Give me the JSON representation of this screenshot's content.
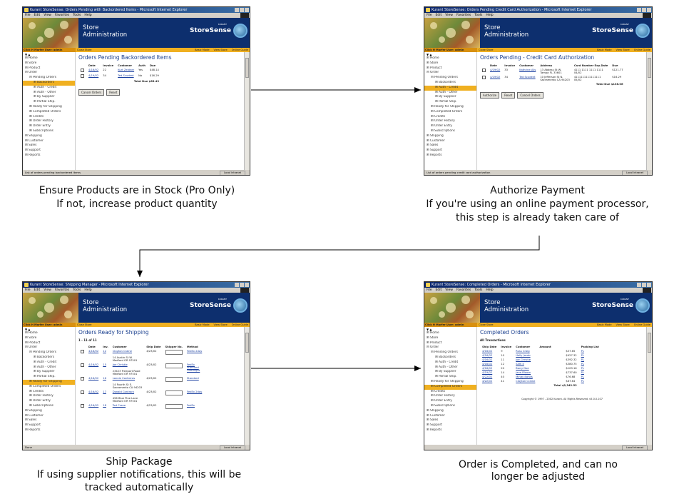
{
  "panels": {
    "p1": {
      "window_title": "Kurant StoreSense: Orders Pending with Backordered Items - Microsoft Internet Explorer",
      "status": "List of orders pending backordered items",
      "page_title": "Orders Pending Backordered Items",
      "selected_tree": "Backorders",
      "headers": [
        "Date",
        "Invoice",
        "Customer",
        "Auth",
        "Due"
      ],
      "rows": [
        {
          "date": "4/16/02",
          "invoice": "22",
          "customer": "Kurt Zeldner",
          "auth": "Yes",
          "due": "$48.14"
        },
        {
          "date": "4/19/02",
          "invoice": "34",
          "customer": "Ted Scudent",
          "auth": "No",
          "due": "$16.29"
        }
      ],
      "total": "Total Due $56.43",
      "buttons": [
        "Cancel Orders",
        "Reset"
      ]
    },
    "p2": {
      "window_title": "Kurant StoreSense: Orders Pending Credit Card Authorization - Microsoft Internet Explorer",
      "status": "List of orders pending credit card authorization",
      "page_title": "Orders Pending - Credit Card Authorization",
      "selected_tree": "Auth - Credit",
      "headers": [
        "Date",
        "Invoice",
        "Customer",
        "Address",
        "Card Number Exp.Date",
        "Due"
      ],
      "rows": [
        {
          "date": "4/19/02",
          "invoice": "33",
          "customer": "Kathrine Alis",
          "address1": "13 Abbess St W.",
          "address2": "Tampa FL 33601",
          "card1": "4111 1111 1111 1111",
          "card2": "04/02",
          "due": "$121.77"
        },
        {
          "date": "4/19/02",
          "invoice": "34",
          "customer": "Ted Scudent",
          "address1": "10 Jefferson St N.",
          "address2": "Sacramento CA 94203",
          "card1": "4111111111111111",
          "card2": "05/02",
          "due": "$16.29"
        }
      ],
      "total": "Total Due $138.06",
      "buttons": [
        "Authorize",
        "Reset",
        "Cancel Orders"
      ]
    },
    "p3": {
      "window_title": "Kurant StoreSense: Shipping Manager - Microsoft Internet Explorer",
      "status": "Done",
      "page_title": "Orders Ready for Shipping",
      "range": "1 - 11 of 11",
      "selected_tree": "Ready for Shipping",
      "headers": [
        "Date",
        "Inv.",
        "Customer",
        "Ship Date",
        "Shipper No.",
        "Method"
      ],
      "rows": [
        {
          "date": "4/16/02",
          "invoice": "12",
          "customer": "Clayton Craine",
          "addr1": "14 Austin St W.",
          "addr2": "Medford OR 97501",
          "ship": "4/23/02",
          "method": "FedEx 2day"
        },
        {
          "date": "4/16/02",
          "invoice": "15",
          "customer": "Joe Christie",
          "addr1": "23423 Freeport Road",
          "addr2": "Medford OR 97501",
          "ship": "4/23/02",
          "method": "FedEx Standard Overnight"
        },
        {
          "date": "4/16/02",
          "invoice": "16",
          "customer": "Lonnie Contreras",
          "addr1": "14 Fourth St E.",
          "addr2": "Sacramento CA 94203",
          "ship": "4/23/02",
          "method": "Standard"
        },
        {
          "date": "4/16/02",
          "invoice": "17",
          "customer": "Donald Contrary",
          "addr1": "456 Blue Pine Lane",
          "addr2": "Medford OR 97501",
          "ship": "4/23/02",
          "method": "FedEx 2day"
        },
        {
          "date": "4/16/02",
          "invoice": "18",
          "customer": "Ted Crane",
          "addr1": "",
          "addr2": "",
          "ship": "4/23/02",
          "method": "FedEx"
        }
      ]
    },
    "p4": {
      "window_title": "Kurant StoreSense: Completed Orders - Microsoft Internet Explorer",
      "status": "",
      "page_title": "Completed Orders",
      "sub": "All Transactions",
      "selected_tree": "Completed Orders",
      "headers": [
        "Ship Date",
        "Invoice",
        "Customer",
        "Amount",
        "Packing List"
      ],
      "rows": [
        {
          "date": "4/16/02",
          "invoice": "9",
          "customer": "Russ Craig",
          "amount": "$57.65",
          "pl": "PL"
        },
        {
          "date": "4/16/02",
          "invoice": "10",
          "customer": "Holly Jacob",
          "amount": "$927.32",
          "pl": "PL"
        },
        {
          "date": "4/16/02",
          "invoice": "11",
          "customer": "Joe Christie",
          "amount": "$392.32",
          "pl": "PL"
        },
        {
          "date": "4/16/02",
          "invoice": "12",
          "customer": "Sam E",
          "amount": "$380.75",
          "pl": "PL"
        },
        {
          "date": "4/16/02",
          "invoice": "20",
          "customer": "Barry Doe",
          "amount": "$109.16",
          "pl": "PL"
        },
        {
          "date": "4/19/02",
          "invoice": "14",
          "customer": "Jane Bloom",
          "amount": "$737.60",
          "pl": "PL"
        },
        {
          "date": "4/22/02",
          "invoice": "40",
          "customer": "Mindy Bonds",
          "amount": "$76.68",
          "pl": "PL"
        },
        {
          "date": "4/22/02",
          "invoice": "41",
          "customer": "Clayton Craine",
          "amount": "$67.64",
          "pl": "PL"
        }
      ],
      "total": "Total $2,342.52",
      "copyright": "Copyright © 1997 - 2002 Kurant. All Rights Reserved. v5.0.0.107"
    }
  },
  "common": {
    "menu": [
      "File",
      "Edit",
      "View",
      "Favorites",
      "Tools",
      "Help"
    ],
    "store_line1": "Store",
    "store_line2": "Administration",
    "brand": "StoreSense",
    "brand_small": "KURANT",
    "who": "Click H Marfer  User: admin",
    "close_store": "Close Store",
    "nav_links": [
      "Basic Mode",
      "View Store",
      "Online Guide"
    ],
    "zone": "Local intranet",
    "tree": [
      "Home",
      "Store",
      "Product",
      "Order",
      "Pending Orders",
      "Backorders",
      "Auth - Credit",
      "Auth - Other",
      "By Supplier",
      "Partial Ship.",
      "Ready for Shipping",
      "Completed Orders",
      "Credits",
      "Order History",
      "Order Entry",
      "Subscriptions",
      "Shipping",
      "Customer",
      "Sales",
      "Support",
      "Reports"
    ]
  },
  "captions": {
    "c1_line1": "Ensure Products are in Stock (Pro Only)",
    "c1_line2": "If not, increase product quantity",
    "c2_line1": "Authorize Payment",
    "c2_line2": "If you're using an online payment processor,",
    "c2_line3": "this step is already taken care of",
    "c3_line1": "Ship Package",
    "c3_line2": "If using supplier notifications, this will be",
    "c3_line3": "tracked automatically",
    "c4_line1": "Order is Completed, and can no",
    "c4_line2": "longer be adjusted"
  }
}
